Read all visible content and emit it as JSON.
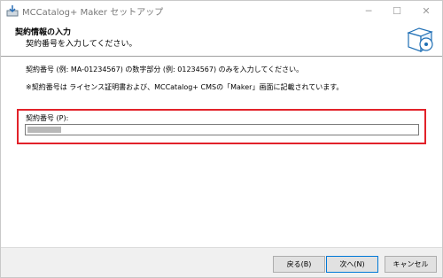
{
  "window": {
    "title": "MCCatalog+ Maker セットアップ",
    "minimize_glyph": "─",
    "maximize_glyph": "☐",
    "close_glyph": "✕",
    "app_icon": "installer-icon"
  },
  "header": {
    "title": "契約情報の入力",
    "subtitle": "契約番号を入力してください。",
    "image_icon": "cd-box-icon"
  },
  "body": {
    "description_1": "契約番号 (例: MA-01234567) の数字部分 (例: 01234567) のみを入力してください。",
    "description_2": "※契約番号は ライセンス証明書および、MCCatalog+ CMSの「Maker」画面に記載されています。",
    "field_label": "契約番号 (P):",
    "field_value": ""
  },
  "footer": {
    "back_label": "戻る(B)",
    "next_label": "次へ(N)",
    "cancel_label": "キャンセル"
  },
  "colors": {
    "highlight": "#e2222a",
    "accent": "#0078d7"
  }
}
